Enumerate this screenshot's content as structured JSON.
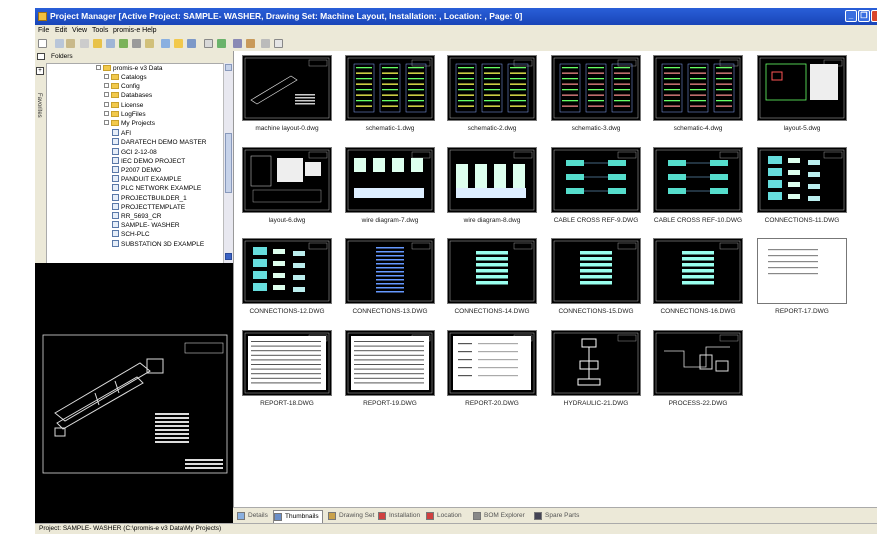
{
  "window": {
    "title": "Project Manager [Active Project: SAMPLE- WASHER, Drawing Set: Machine Layout, Installation: , Location: , Page: 0]"
  },
  "menu": [
    "File",
    "Edit",
    "View",
    "Tools",
    "promis-e Help"
  ],
  "folders_label": "Folders",
  "favorites_label": "Favorites",
  "tree": {
    "root": "promis-e v3 Data",
    "items": [
      {
        "label": "Catalogs",
        "type": "folder",
        "level": 1
      },
      {
        "label": "Config",
        "type": "folder",
        "level": 1
      },
      {
        "label": "Databases",
        "type": "folder",
        "level": 1
      },
      {
        "label": "License",
        "type": "folder",
        "level": 1
      },
      {
        "label": "LogFiles",
        "type": "folder",
        "level": 1
      },
      {
        "label": "My Projects",
        "type": "folder",
        "level": 1
      },
      {
        "label": "AFI",
        "type": "project",
        "level": 2
      },
      {
        "label": "DARATECH DEMO MASTER",
        "type": "project",
        "level": 2
      },
      {
        "label": "GCI 2-12-08",
        "type": "project",
        "level": 2
      },
      {
        "label": "IEC DEMO PROJECT",
        "type": "project",
        "level": 2
      },
      {
        "label": "P2007 DEMO",
        "type": "project",
        "level": 2
      },
      {
        "label": "PANDUIT EXAMPLE",
        "type": "project",
        "level": 2
      },
      {
        "label": "PLC NETWORK EXAMPLE",
        "type": "project",
        "level": 2
      },
      {
        "label": "PROJECTBUILDER_1",
        "type": "project",
        "level": 2
      },
      {
        "label": "PROJECTTEMPLATE",
        "type": "project",
        "level": 2
      },
      {
        "label": "RR_5693_CR",
        "type": "project",
        "level": 2
      },
      {
        "label": "SAMPLE- WASHER",
        "type": "project",
        "level": 2
      },
      {
        "label": "SCH-PLC",
        "type": "project",
        "level": 2
      },
      {
        "label": "SUBSTATION 3D EXAMPLE",
        "type": "project",
        "level": 2
      }
    ]
  },
  "thumbnails": [
    {
      "label": "machine layout-0.dwg",
      "kind": "layout"
    },
    {
      "label": "schematic-1.dwg",
      "kind": "schematic"
    },
    {
      "label": "schematic-2.dwg",
      "kind": "schematic"
    },
    {
      "label": "schematic-3.dwg",
      "kind": "schematic"
    },
    {
      "label": "schematic-4.dwg",
      "kind": "schematic"
    },
    {
      "label": "layout-5.dwg",
      "kind": "layout"
    },
    {
      "label": "layout-6.dwg",
      "kind": "layout"
    },
    {
      "label": "wire diagram-7.dwg",
      "kind": "wire"
    },
    {
      "label": "wire diagram-8.dwg",
      "kind": "wire"
    },
    {
      "label": "CABLE CROSS REF-9.DWG",
      "kind": "cable"
    },
    {
      "label": "CABLE CROSS REF-10.DWG",
      "kind": "cable"
    },
    {
      "label": "CONNECTIONS-11.DWG",
      "kind": "connections"
    },
    {
      "label": "CONNECTIONS-12.DWG",
      "kind": "connections"
    },
    {
      "label": "CONNECTIONS-13.DWG",
      "kind": "connections"
    },
    {
      "label": "CONNECTIONS-14.DWG",
      "kind": "connections"
    },
    {
      "label": "CONNECTIONS-15.DWG",
      "kind": "connections"
    },
    {
      "label": "CONNECTIONS-16.DWG",
      "kind": "connections"
    },
    {
      "label": "REPORT-17.DWG",
      "kind": "report-white"
    },
    {
      "label": "REPORT-18.DWG",
      "kind": "report"
    },
    {
      "label": "REPORT-19.DWG",
      "kind": "report"
    },
    {
      "label": "REPORT-20.DWG",
      "kind": "report"
    },
    {
      "label": "HYDRAULIC-21.DWG",
      "kind": "hydraulic"
    },
    {
      "label": "PROCESS-22.DWG",
      "kind": "process"
    }
  ],
  "tabs": [
    {
      "label": "Details",
      "active": false
    },
    {
      "label": "Thumbnails",
      "active": true
    },
    {
      "label": "Drawing Set",
      "active": false
    },
    {
      "label": "Installation",
      "active": false
    },
    {
      "label": "Location",
      "active": false
    },
    {
      "label": "BOM Explorer",
      "active": false
    },
    {
      "label": "Spare Parts",
      "active": false
    }
  ],
  "status": "Project: SAMPLE- WASHER (C:\\promis-e v3 Data\\My Projects)",
  "colors": {
    "titlebar": "#1f4fc8",
    "chrome": "#ece9d8",
    "thumbnail_bg": "#000000"
  }
}
